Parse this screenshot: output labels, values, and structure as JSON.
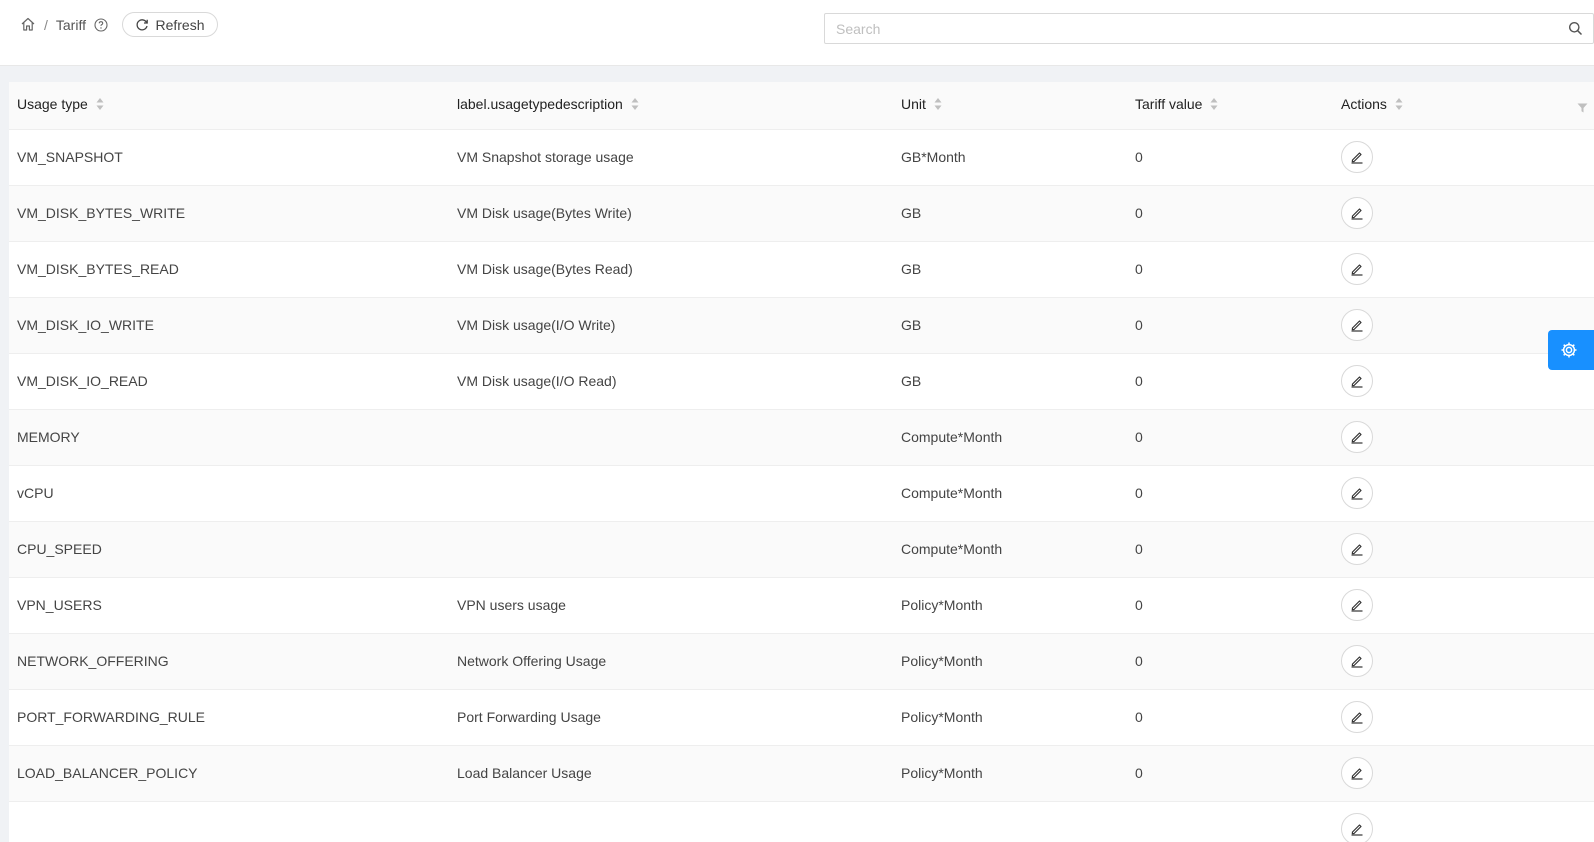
{
  "breadcrumb": {
    "page": "Tariff"
  },
  "toolbar": {
    "refresh_label": "Refresh"
  },
  "search": {
    "placeholder": "Search"
  },
  "table": {
    "columns": [
      "Usage type",
      "label.usagetypedescription",
      "Unit",
      "Tariff value",
      "Actions"
    ],
    "rows": [
      [
        "VM_SNAPSHOT",
        "VM Snapshot storage usage",
        "GB*Month",
        "0"
      ],
      [
        "VM_DISK_BYTES_WRITE",
        "VM Disk usage(Bytes Write)",
        "GB",
        "0"
      ],
      [
        "VM_DISK_BYTES_READ",
        "VM Disk usage(Bytes Read)",
        "GB",
        "0"
      ],
      [
        "VM_DISK_IO_WRITE",
        "VM Disk usage(I/O Write)",
        "GB",
        "0"
      ],
      [
        "VM_DISK_IO_READ",
        "VM Disk usage(I/O Read)",
        "GB",
        "0"
      ],
      [
        "MEMORY",
        "",
        "Compute*Month",
        "0"
      ],
      [
        "vCPU",
        "",
        "Compute*Month",
        "0"
      ],
      [
        "CPU_SPEED",
        "",
        "Compute*Month",
        "0"
      ],
      [
        "VPN_USERS",
        "VPN users usage",
        "Policy*Month",
        "0"
      ],
      [
        "NETWORK_OFFERING",
        "Network Offering Usage",
        "Policy*Month",
        "0"
      ],
      [
        "PORT_FORWARDING_RULE",
        "Port Forwarding Usage",
        "Policy*Month",
        "0"
      ],
      [
        "LOAD_BALANCER_POLICY",
        "Load Balancer Usage",
        "Policy*Month",
        "0"
      ],
      [
        "",
        "",
        "",
        ""
      ]
    ]
  },
  "icons": {
    "home": "home-icon",
    "help": "question-circle-icon",
    "refresh": "reload-icon",
    "search": "search-icon",
    "sort": "caret-sort-icon",
    "filter": "filter-icon",
    "edit": "edit-pencil-icon",
    "settings": "gear-icon"
  },
  "colors": {
    "accent": "#1890ff",
    "border": "#d9d9d9",
    "row_alt": "#fafafa"
  }
}
